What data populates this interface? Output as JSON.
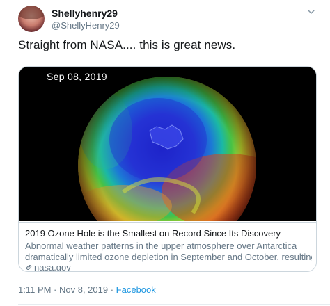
{
  "user": {
    "display_name": "Shellyhenry29",
    "handle": "@ShellyHenry29"
  },
  "tweet": {
    "text": "Straight from NASA.... this is great news."
  },
  "card": {
    "image_date": "Sep 08, 2019",
    "title": "2019 Ozone Hole is the Smallest on Record Since Its Discovery",
    "description_line1": "Abnormal weather patterns in the upper atmosphere over Antarctica",
    "description_line2": "dramatically limited ozone depletion in September and October, resulting in th...",
    "domain": "nasa.gov"
  },
  "meta": {
    "timestamp": "1:11 PM · Nov 8, 2019",
    "separator": " · ",
    "source": "Facebook"
  },
  "icons": {
    "caret": "chevron-down-icon",
    "link": "link-icon"
  },
  "colors": {
    "text_primary": "#14171a",
    "text_secondary": "#657786",
    "link_blue": "#1b95e0",
    "border": "#ccd6dd"
  }
}
